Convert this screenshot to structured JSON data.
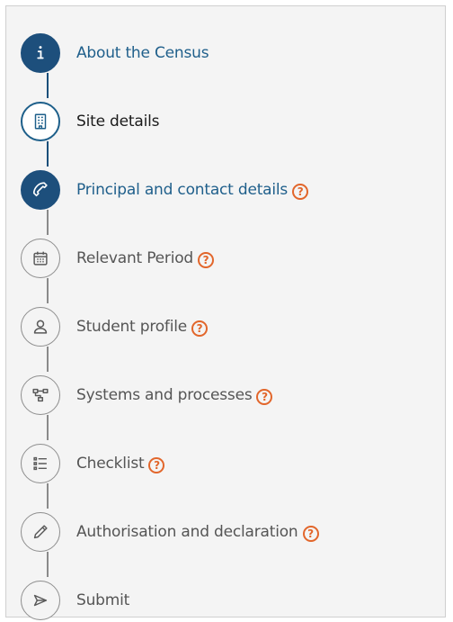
{
  "steps": [
    {
      "label": "About the Census",
      "icon": "info-icon",
      "state": "done",
      "help": false
    },
    {
      "label": "Site details",
      "icon": "building-icon",
      "state": "current",
      "help": false
    },
    {
      "label": "Principal and contact details",
      "icon": "phone-icon",
      "state": "done",
      "help": true
    },
    {
      "label": "Relevant Period",
      "icon": "calendar-icon",
      "state": "pending",
      "help": true
    },
    {
      "label": "Student profile",
      "icon": "user-icon",
      "state": "pending",
      "help": true
    },
    {
      "label": "Systems and processes",
      "icon": "hierarchy-icon",
      "state": "pending",
      "help": true
    },
    {
      "label": "Checklist",
      "icon": "list-icon",
      "state": "pending",
      "help": true
    },
    {
      "label": "Authorisation and declaration",
      "icon": "pencil-icon",
      "state": "pending",
      "help": true
    },
    {
      "label": "Submit",
      "icon": "send-icon",
      "state": "pending",
      "help": false
    }
  ],
  "help_symbol": "?",
  "colors": {
    "done": "#1d4f7c",
    "link_text": "#1f5f8b",
    "help": "#e2662b",
    "pending": "#8e8e8e"
  }
}
